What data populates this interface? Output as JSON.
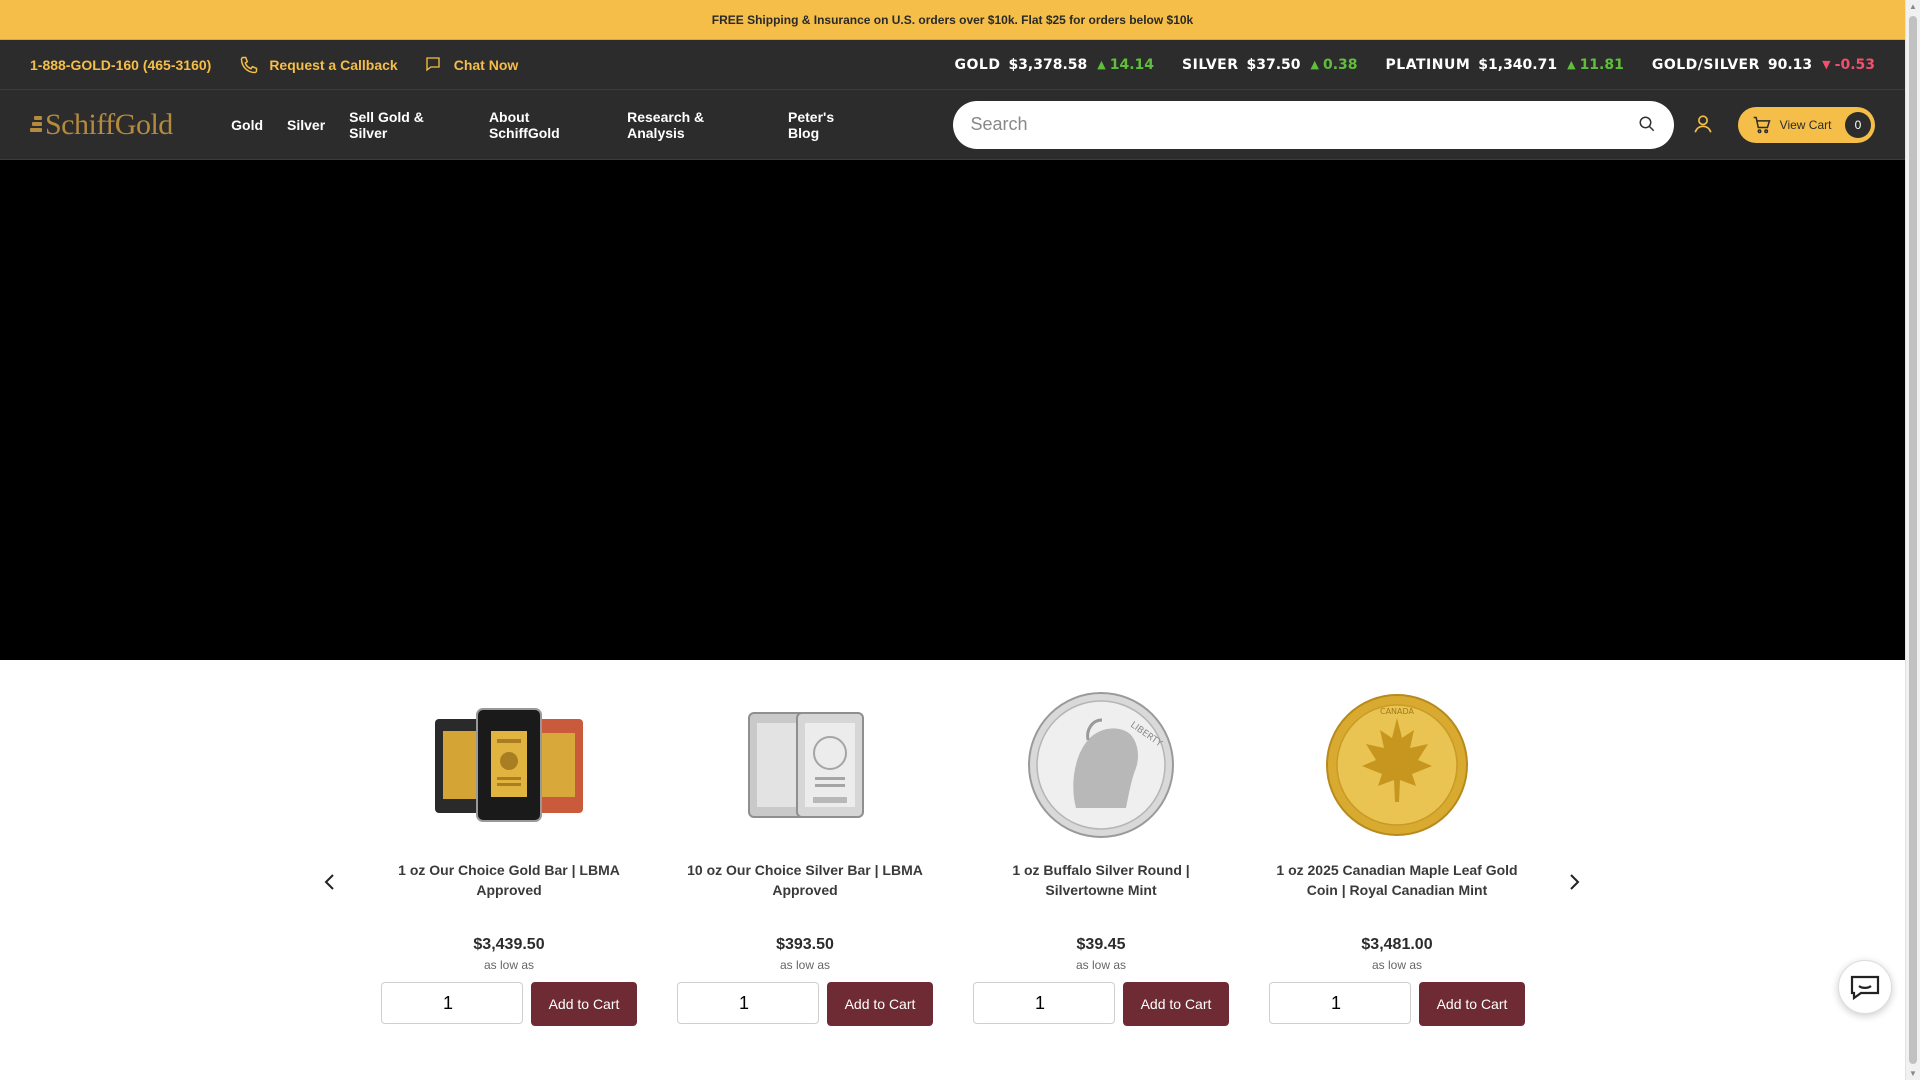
{
  "announcement": "FREE Shipping & Insurance on U.S. orders over $10k. Flat $25 for orders below $10k",
  "topbar": {
    "phone": "1-888-GOLD-160 (465-3160)",
    "callback": "Request a Callback",
    "chat": "Chat Now",
    "tickers": [
      {
        "label": "GOLD",
        "price": "$3,378.58",
        "change": "14.14",
        "direction": "up"
      },
      {
        "label": "SILVER",
        "price": "$37.50",
        "change": "0.38",
        "direction": "up"
      },
      {
        "label": "PLATINUM",
        "price": "$1,340.71",
        "change": "11.81",
        "direction": "up"
      },
      {
        "label": "GOLD/SILVER",
        "price": "90.13",
        "change": "-0.53",
        "direction": "down"
      }
    ]
  },
  "logo": {
    "text": "SchiffGold"
  },
  "nav": {
    "items": [
      "Gold",
      "Silver",
      "Sell Gold & Silver",
      "About SchiffGold",
      "Research & Analysis",
      "Peter's Blog"
    ]
  },
  "search": {
    "placeholder": "Search"
  },
  "cart": {
    "label": "View Cart",
    "count": "0"
  },
  "products": [
    {
      "name": "1 oz Our Choice Gold Bar | LBMA Approved",
      "price": "$3,439.50",
      "as_low_as": "as low as",
      "qty": "1",
      "add_label": "Add to Cart"
    },
    {
      "name": "10 oz Our Choice Silver Bar | LBMA Approved",
      "price": "$393.50",
      "as_low_as": "as low as",
      "qty": "1",
      "add_label": "Add to Cart"
    },
    {
      "name": "1 oz Buffalo Silver Round | Silvertowne Mint",
      "price": "$39.45",
      "as_low_as": "as low as",
      "qty": "1",
      "add_label": "Add to Cart"
    },
    {
      "name": "1 oz 2025 Canadian Maple Leaf Gold Coin | Royal Canadian Mint",
      "price": "$3,481.00",
      "as_low_as": "as low as",
      "qty": "1",
      "add_label": "Add to Cart"
    }
  ],
  "coin_text": {
    "liberty": "LIBERTY",
    "canada": "CANADA"
  },
  "colors": {
    "accent": "#f4be48",
    "header_bg": "#2c2c2c",
    "button": "#6e2b33",
    "up": "#5fbf3a",
    "down": "#f0506e"
  }
}
